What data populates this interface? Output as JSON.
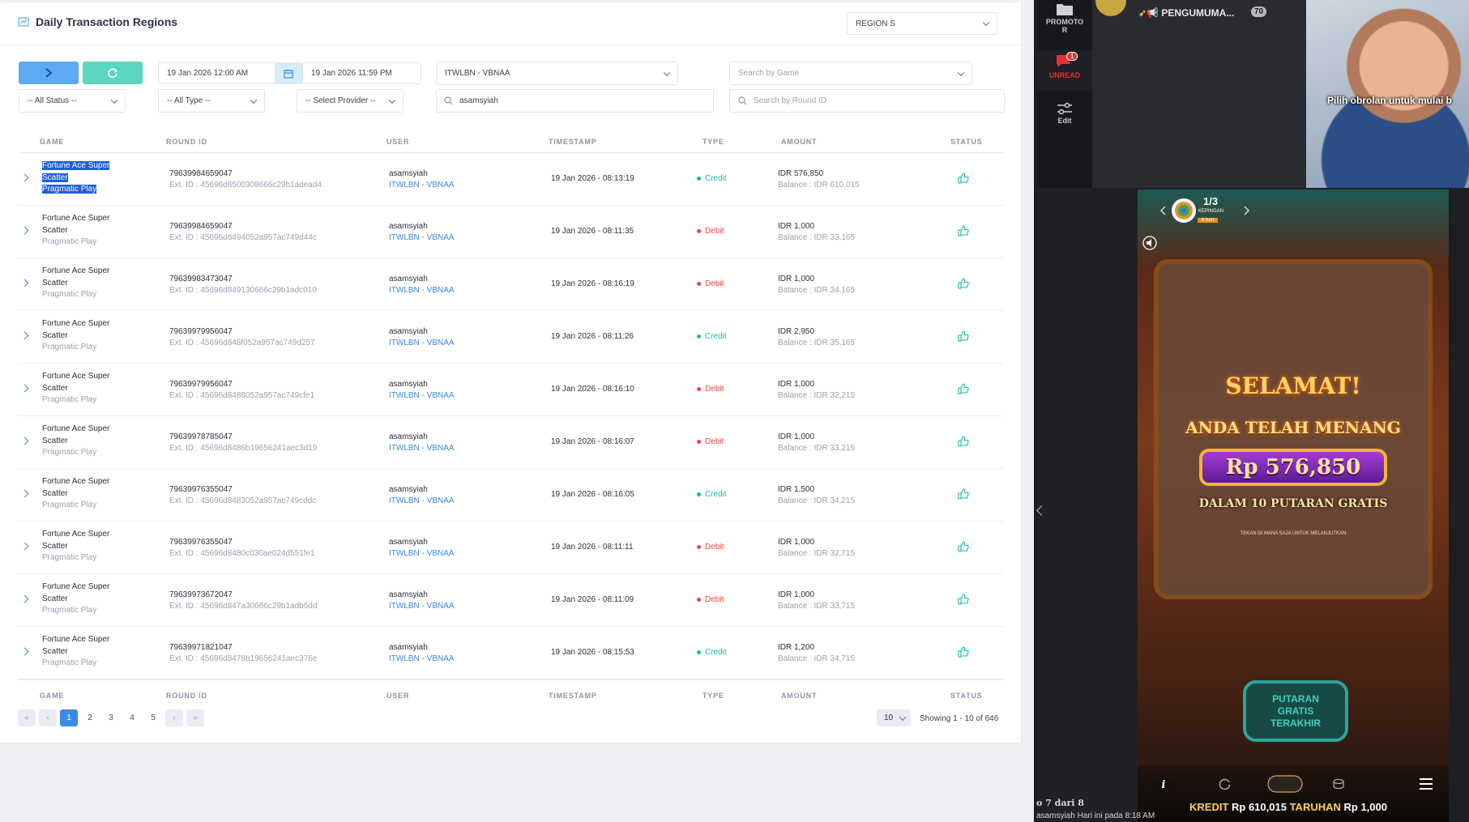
{
  "panel": {
    "title": "Daily Transaction Regions",
    "region_select": "REGION S"
  },
  "filters": {
    "date_from": "19 Jan 2026 12:00 AM",
    "date_to": "19 Jan 2026 11:59 PM",
    "agent": "ITWLBN - VBNAA",
    "search_game_placeholder": "Search by Game",
    "status": "-- All Status --",
    "type": "-- All Type --",
    "provider": "-- Select Provider --",
    "user_search": "asamsyiah",
    "round_search_placeholder": "Search by Round ID"
  },
  "table": {
    "headers": [
      "GAME",
      "ROUND ID",
      "USER",
      "TIMESTAMP",
      "TYPE",
      "AMOUNT",
      "STATUS"
    ],
    "rows": [
      {
        "game": "Fortune Ace Super",
        "game2": "Scatter",
        "provider": "Pragmatic Play",
        "round_id": "79639984659047",
        "ext": "Ext. ID : 45696d8500308666c29b1adead4",
        "user": "asamsyiah",
        "agent": "ITWLBN - VBNAA",
        "timestamp": "19 Jan 2026 - 08:13:19",
        "type": "Credit",
        "amount": "IDR 576,850",
        "balance": "Balance : IDR 610,015"
      },
      {
        "game": "Fortune Ace Super",
        "game2": "Scatter",
        "provider": "Pragmatic Play",
        "round_id": "79639984659047",
        "ext": "Ext. ID : 45696d8494052a957ac749d44c",
        "user": "asamsyiah",
        "agent": "ITWLBN - VBNAA",
        "timestamp": "19 Jan 2026 - 08:11:35",
        "type": "Debit",
        "amount": "IDR 1,000",
        "balance": "Balance : IDR 33,165"
      },
      {
        "game": "Fortune Ace Super",
        "game2": "Scatter",
        "provider": "Pragmatic Play",
        "round_id": "79639983473047",
        "ext": "Ext. ID : 45696d849130666c29b1adc010",
        "user": "asamsyiah",
        "agent": "ITWLBN - VBNAA",
        "timestamp": "19 Jan 2026 - 08:16:19",
        "type": "Debit",
        "amount": "IDR 1,000",
        "balance": "Balance : IDR 34,165"
      },
      {
        "game": "Fortune Ace Super",
        "game2": "Scatter",
        "provider": "Pragmatic Play",
        "round_id": "79639979956047",
        "ext": "Ext. ID : 45696d848f052a957ac749d257",
        "user": "asamsyiah",
        "agent": "ITWLBN - VBNAA",
        "timestamp": "19 Jan 2026 - 08:11:26",
        "type": "Credit",
        "amount": "IDR 2,950",
        "balance": "Balance : IDR 35,165"
      },
      {
        "game": "Fortune Ace Super",
        "game2": "Scatter",
        "provider": "Pragmatic Play",
        "round_id": "79639979956047",
        "ext": "Ext. ID : 45696d8488052a957ac749cfe1",
        "user": "asamsyiah",
        "agent": "ITWLBN - VBNAA",
        "timestamp": "19 Jan 2026 - 08:16:10",
        "type": "Debit",
        "amount": "IDR 1,000",
        "balance": "Balance : IDR 32,215"
      },
      {
        "game": "Fortune Ace Super",
        "game2": "Scatter",
        "provider": "Pragmatic Play",
        "round_id": "79639978785047",
        "ext": "Ext. ID : 45696d8486b19656241aec3d19",
        "user": "asamsyiah",
        "agent": "ITWLBN - VBNAA",
        "timestamp": "19 Jan 2026 - 08:16:07",
        "type": "Debit",
        "amount": "IDR 1,000",
        "balance": "Balance : IDR 33,215"
      },
      {
        "game": "Fortune Ace Super",
        "game2": "Scatter",
        "provider": "Pragmatic Play",
        "round_id": "79639976355047",
        "ext": "Ext. ID : 45696d8483052a957ac749cddc",
        "user": "asamsyiah",
        "agent": "ITWLBN - VBNAA",
        "timestamp": "19 Jan 2026 - 08:16:05",
        "type": "Credit",
        "amount": "IDR 1,500",
        "balance": "Balance : IDR 34,215"
      },
      {
        "game": "Fortune Ace Super",
        "game2": "Scatter",
        "provider": "Pragmatic Play",
        "round_id": "79639976355047",
        "ext": "Ext. ID : 45696d8480c030ae024d551fe1",
        "user": "asamsyiah",
        "agent": "ITWLBN - VBNAA",
        "timestamp": "19 Jan 2026 - 08:11:11",
        "type": "Debit",
        "amount": "IDR 1,000",
        "balance": "Balance : IDR 32,715"
      },
      {
        "game": "Fortune Ace Super",
        "game2": "Scatter",
        "provider": "Pragmatic Play",
        "round_id": "79639973672047",
        "ext": "Ext. ID : 45696d847a30666c29b1adb6dd",
        "user": "asamsyiah",
        "agent": "ITWLBN - VBNAA",
        "timestamp": "19 Jan 2026 - 08:11:09",
        "type": "Debit",
        "amount": "IDR 1,000",
        "balance": "Balance : IDR 33,715"
      },
      {
        "game": "Fortune Ace Super",
        "game2": "Scatter",
        "provider": "Pragmatic Play",
        "round_id": "79639971821047",
        "ext": "Ext. ID : 45696d8478b19656241aec376e",
        "user": "asamsyiah",
        "agent": "ITWLBN - VBNAA",
        "timestamp": "19 Jan 2026 - 08:15:53",
        "type": "Credit",
        "amount": "IDR 1,200",
        "balance": "Balance : IDR 34,715"
      }
    ]
  },
  "pagination": {
    "first": "«",
    "prev": "‹",
    "next": "›",
    "last": "»",
    "pages": [
      "1",
      "2",
      "3",
      "4",
      "5"
    ],
    "per_page": "10",
    "showing": "Showing 1 - 10 of 646"
  },
  "colors": {
    "credit": "#14b8a6",
    "debit": "#ef4444",
    "link": "#3a86d9",
    "primary": "#3a8ae8"
  },
  "chat": {
    "rail_promo": "PROMOTO",
    "rail_promo2": "R",
    "rail_unread": "UNREAD",
    "rail_unread_count": "1",
    "rail_edit": "Edit",
    "channel_name": "PENGUMUMA...",
    "channel_count": "70",
    "mascot_caption": "Pilih obrolan untuk mulai b",
    "footer_line1": "o 7 dari 8",
    "footer_line2": "asamsyiah   Hari ini pada 8:18 AM"
  },
  "game": {
    "spin_fraction": "1/3",
    "spin_label": "KEPINGAN",
    "spin_days": "6 hari",
    "selamat": "SELAMAT!",
    "menang": "ANDA TELAH MENANG",
    "win_amount": "Rp 576,850",
    "free_spins": "DALAM 10 PUTARAN GRATIS",
    "tap_text": "TEKAN DI MANA SAJA UNTUK MELANJUTKAN",
    "last_free_spins": "PUTARAN GRATIS TERAKHIR",
    "kredit_label": "KREDIT",
    "kredit_value": "Rp 610,015",
    "taruhan_label": "TARUHAN",
    "taruhan_value": "Rp 1,000"
  }
}
